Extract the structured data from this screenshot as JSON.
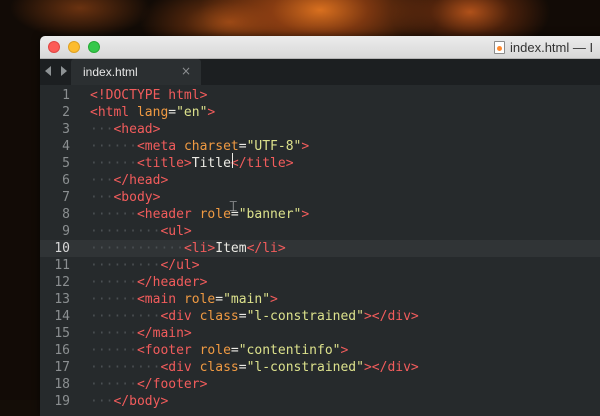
{
  "window": {
    "title": "index.html — I",
    "file_icon": "html-file-icon"
  },
  "tabs": [
    {
      "label": "index.html",
      "active": true,
      "close_glyph": "×"
    }
  ],
  "nav": {
    "back_icon": "arrow-left-icon",
    "forward_icon": "arrow-right-icon"
  },
  "editor": {
    "current_line": 10,
    "lines": [
      {
        "num": "1",
        "indent": 0,
        "tokens": [
          [
            "tg",
            "<!DOCTYPE html>"
          ]
        ]
      },
      {
        "num": "2",
        "indent": 0,
        "tokens": [
          [
            "tg",
            "<html "
          ],
          [
            "at",
            "lang"
          ],
          [
            "tx",
            "="
          ],
          [
            "st",
            "\"en\""
          ],
          [
            "tg",
            ">"
          ]
        ]
      },
      {
        "num": "3",
        "indent": 1,
        "tokens": [
          [
            "tg",
            "<head>"
          ]
        ]
      },
      {
        "num": "4",
        "indent": 2,
        "tokens": [
          [
            "tg",
            "<meta "
          ],
          [
            "at",
            "charset"
          ],
          [
            "tx",
            "="
          ],
          [
            "st",
            "\"UTF-8\""
          ],
          [
            "tg",
            ">"
          ]
        ]
      },
      {
        "num": "5",
        "indent": 2,
        "tokens": [
          [
            "tg",
            "<title>"
          ],
          [
            "tx",
            "Title"
          ],
          [
            "tg",
            "</title>"
          ]
        ]
      },
      {
        "num": "6",
        "indent": 1,
        "tokens": [
          [
            "tg",
            "</head>"
          ]
        ]
      },
      {
        "num": "7",
        "indent": 1,
        "tokens": [
          [
            "tg",
            "<body>"
          ]
        ]
      },
      {
        "num": "8",
        "indent": 2,
        "tokens": [
          [
            "tg",
            "<header "
          ],
          [
            "at",
            "role"
          ],
          [
            "tx",
            "="
          ],
          [
            "st",
            "\"banner\""
          ],
          [
            "tg",
            ">"
          ]
        ]
      },
      {
        "num": "9",
        "indent": 3,
        "tokens": [
          [
            "tg",
            "<ul>"
          ]
        ]
      },
      {
        "num": "10",
        "indent": 4,
        "tokens": [
          [
            "tg",
            "<li>"
          ],
          [
            "tx",
            "Item"
          ],
          [
            "tg",
            "</li>"
          ]
        ]
      },
      {
        "num": "11",
        "indent": 3,
        "tokens": [
          [
            "tg",
            "</ul>"
          ]
        ]
      },
      {
        "num": "12",
        "indent": 2,
        "tokens": [
          [
            "tg",
            "</header>"
          ]
        ]
      },
      {
        "num": "13",
        "indent": 2,
        "tokens": [
          [
            "tg",
            "<main "
          ],
          [
            "at",
            "role"
          ],
          [
            "tx",
            "="
          ],
          [
            "st",
            "\"main\""
          ],
          [
            "tg",
            ">"
          ]
        ]
      },
      {
        "num": "14",
        "indent": 3,
        "tokens": [
          [
            "tg",
            "<div "
          ],
          [
            "at",
            "class"
          ],
          [
            "tx",
            "="
          ],
          [
            "st",
            "\"l-constrained\""
          ],
          [
            "tg",
            "></div>"
          ]
        ]
      },
      {
        "num": "15",
        "indent": 2,
        "tokens": [
          [
            "tg",
            "</main>"
          ]
        ]
      },
      {
        "num": "16",
        "indent": 2,
        "tokens": [
          [
            "tg",
            "<footer "
          ],
          [
            "at",
            "role"
          ],
          [
            "tx",
            "="
          ],
          [
            "st",
            "\"contentinfo\""
          ],
          [
            "tg",
            ">"
          ]
        ]
      },
      {
        "num": "17",
        "indent": 3,
        "tokens": [
          [
            "tg",
            "<div "
          ],
          [
            "at",
            "class"
          ],
          [
            "tx",
            "="
          ],
          [
            "st",
            "\"l-constrained\""
          ],
          [
            "tg",
            "></div>"
          ]
        ]
      },
      {
        "num": "18",
        "indent": 2,
        "tokens": [
          [
            "tg",
            "</footer>"
          ]
        ]
      },
      {
        "num": "19",
        "indent": 1,
        "tokens": [
          [
            "tg",
            "</body>"
          ]
        ]
      }
    ]
  },
  "cursor_icon": "text-ibeam-cursor-icon"
}
